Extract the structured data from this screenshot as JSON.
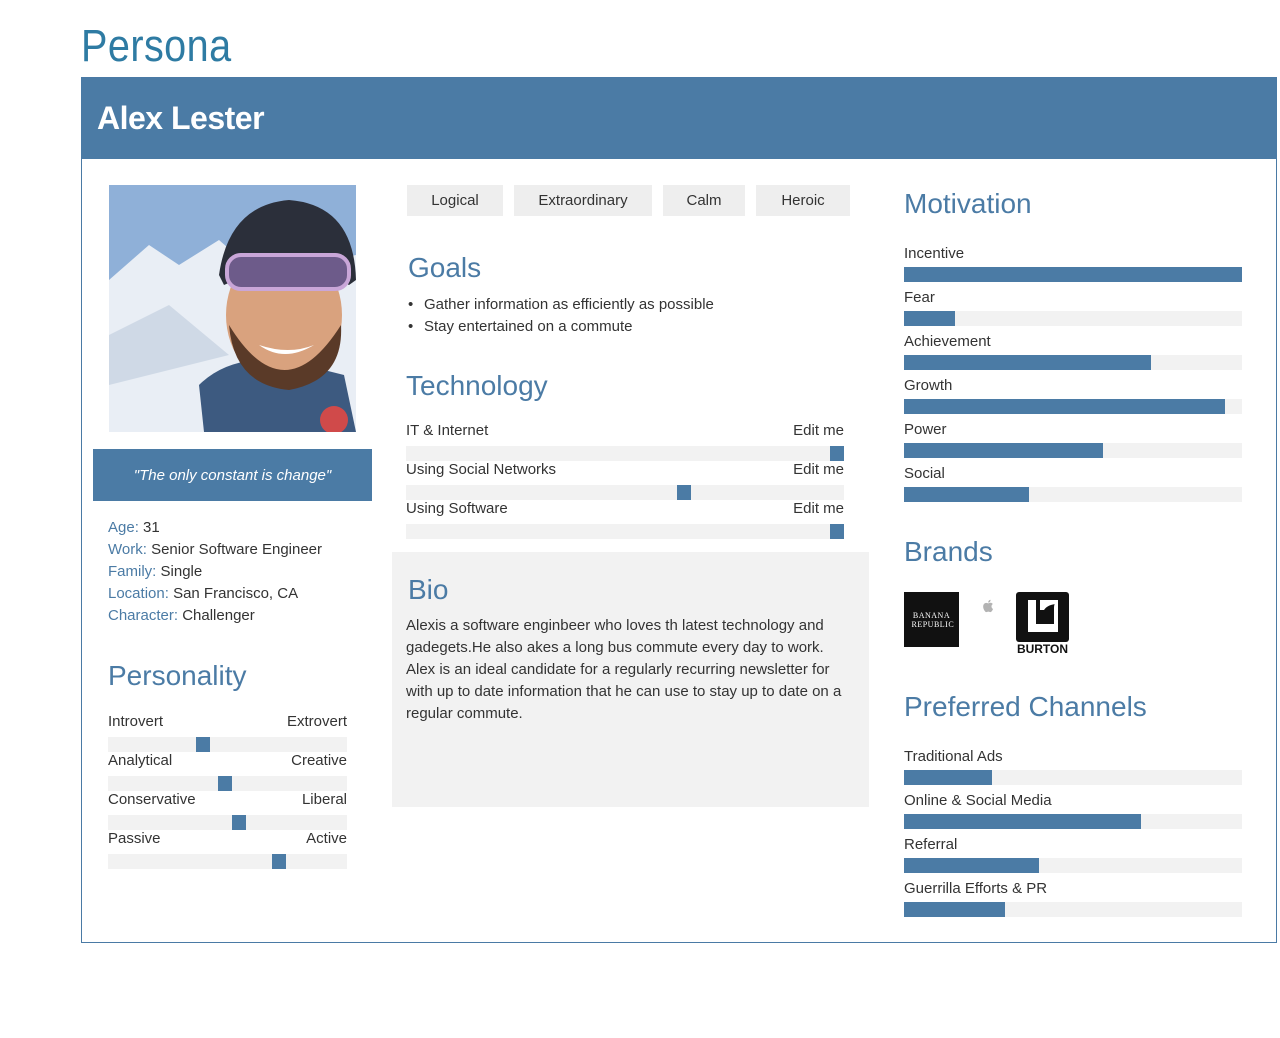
{
  "page_title": "Persona",
  "persona": {
    "name": "Alex Lester",
    "quote": "\"The only constant is change\"",
    "facts": [
      {
        "key": "Age:",
        "value": "31"
      },
      {
        "key": "Work:",
        "value": "Senior Software Engineer"
      },
      {
        "key": "Family:",
        "value": "Single"
      },
      {
        "key": "Location:",
        "value": "San Francisco, CA"
      },
      {
        "key": "Character:",
        "value": "Challenger"
      }
    ]
  },
  "personality": {
    "heading": "Personality",
    "sliders": [
      {
        "left": "Introvert",
        "right": "Extrovert",
        "value": 0.39
      },
      {
        "left": "Analytical",
        "right": "Creative",
        "value": 0.49
      },
      {
        "left": "Conservative",
        "right": "Liberal",
        "value": 0.55
      },
      {
        "left": "Passive",
        "right": "Active",
        "value": 0.73
      }
    ]
  },
  "tags": [
    "Logical",
    "Extraordinary",
    "Calm",
    "Heroic"
  ],
  "goals": {
    "heading": "Goals",
    "items": [
      "Gather information as efficiently as possible",
      "Stay entertained on a commute"
    ]
  },
  "technology": {
    "heading": "Technology",
    "items": [
      {
        "label": "IT & Internet",
        "edit": "Edit me",
        "value": 1.0
      },
      {
        "label": "Using Social Networks",
        "edit": "Edit me",
        "value": 0.64
      },
      {
        "label": "Using Software",
        "edit": "Edit me",
        "value": 1.0
      }
    ]
  },
  "bio": {
    "heading": "Bio",
    "text": "Alexis a software enginbeer who loves th latest technology and gadegets.He also akes a long bus commute every day to work. Alex is an ideal candidate for a regularly recurring newsletter for with up to date information that he can use to stay up to date on a regular commute."
  },
  "motivation": {
    "heading": "Motivation",
    "items": [
      {
        "label": "Incentive",
        "value": 1.0
      },
      {
        "label": "Fear",
        "value": 0.15
      },
      {
        "label": "Achievement",
        "value": 0.73
      },
      {
        "label": "Growth",
        "value": 0.95
      },
      {
        "label": "Power",
        "value": 0.59
      },
      {
        "label": "Social",
        "value": 0.37
      }
    ]
  },
  "brands": {
    "heading": "Brands",
    "logos": [
      "BANANA REPUBLIC",
      "apple",
      "BURTON"
    ]
  },
  "channels": {
    "heading": "Preferred Channels",
    "items": [
      {
        "label": "Traditional Ads",
        "value": 0.26
      },
      {
        "label": "Online & Social Media",
        "value": 0.7
      },
      {
        "label": "Referral",
        "value": 0.4
      },
      {
        "label": "Guerrilla Efforts & PR",
        "value": 0.3
      }
    ]
  },
  "colors": {
    "accent": "#4b7ba5",
    "title": "#2e7ba3",
    "track": "#f2f2f2"
  }
}
